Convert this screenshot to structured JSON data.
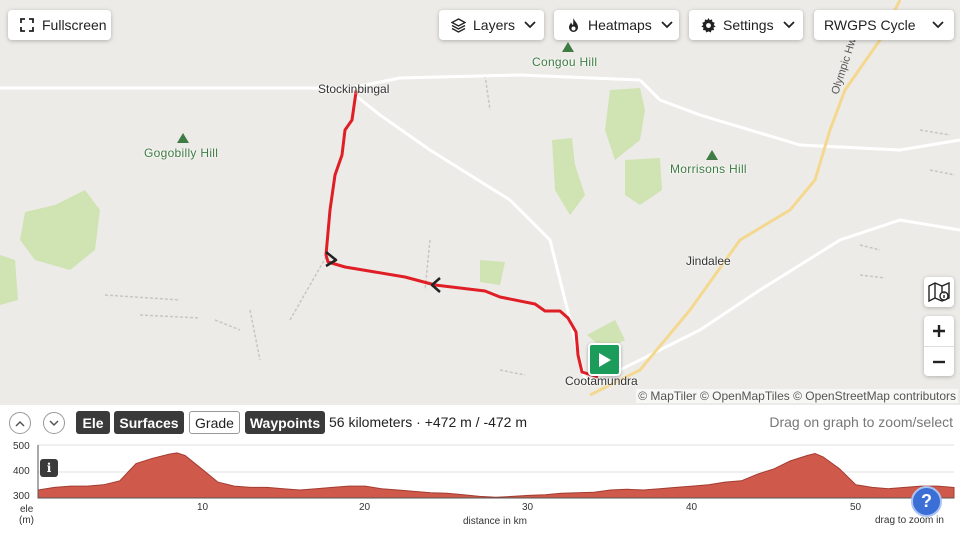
{
  "toolbar": {
    "fullscreen_label": "Fullscreen",
    "layers_label": "Layers",
    "heatmaps_label": "Heatmaps",
    "settings_label": "Settings",
    "basemap_value": "RWGPS Cycle"
  },
  "map": {
    "places": {
      "stockinbingal": "Stockinbingal",
      "cootamundra": "Cootamundra",
      "jindalee": "Jindalee"
    },
    "peaks": {
      "congou": "Congou Hill",
      "gogobilly": "Gogobilly Hill",
      "morrisons": "Morrisons Hill"
    },
    "road_label": "Olympic Hwy",
    "attribution": "© MapTiler © OpenMapTiles © OpenStreetMap contributors",
    "route_color": "#e01e26"
  },
  "elevation": {
    "toggles": {
      "ele": "Ele",
      "surfaces": "Surfaces",
      "grade": "Grade",
      "waypoints": "Waypoints"
    },
    "stats": "56 kilometers · +472 m / -472 m",
    "drag_hint": "Drag on graph to zoom/select",
    "y_ticks": [
      "500",
      "400",
      "300"
    ],
    "x_ticks": [
      "10",
      "20",
      "30",
      "40",
      "50"
    ],
    "y_label_top": "ele",
    "y_label_unit": "(m)",
    "x_label": "distance in km",
    "zoom_hint": "drag to zoom in",
    "info_glyph": "i",
    "help_glyph": "?",
    "fill_color": "#cf5a4b",
    "profile_km": [
      0,
      1,
      2,
      3,
      4,
      5,
      6,
      7,
      8,
      8.5,
      9,
      10,
      11,
      12,
      13,
      14,
      15,
      16,
      17,
      18,
      19,
      20,
      21,
      22,
      23,
      24,
      25,
      26,
      27,
      28,
      29,
      30,
      31,
      32,
      33,
      34,
      35,
      36,
      37,
      38,
      39,
      40,
      41,
      42,
      43,
      44,
      45,
      46,
      47,
      47.5,
      48,
      49,
      50,
      51,
      52,
      53,
      54,
      55,
      56
    ],
    "profile_m": [
      330,
      340,
      345,
      345,
      350,
      365,
      430,
      450,
      465,
      470,
      460,
      410,
      360,
      345,
      340,
      340,
      335,
      330,
      335,
      340,
      345,
      345,
      335,
      330,
      325,
      320,
      318,
      312,
      306,
      303,
      306,
      310,
      312,
      318,
      320,
      322,
      330,
      333,
      330,
      335,
      340,
      345,
      350,
      360,
      365,
      390,
      410,
      440,
      460,
      468,
      455,
      410,
      350,
      340,
      335,
      340,
      345,
      345,
      340
    ]
  }
}
